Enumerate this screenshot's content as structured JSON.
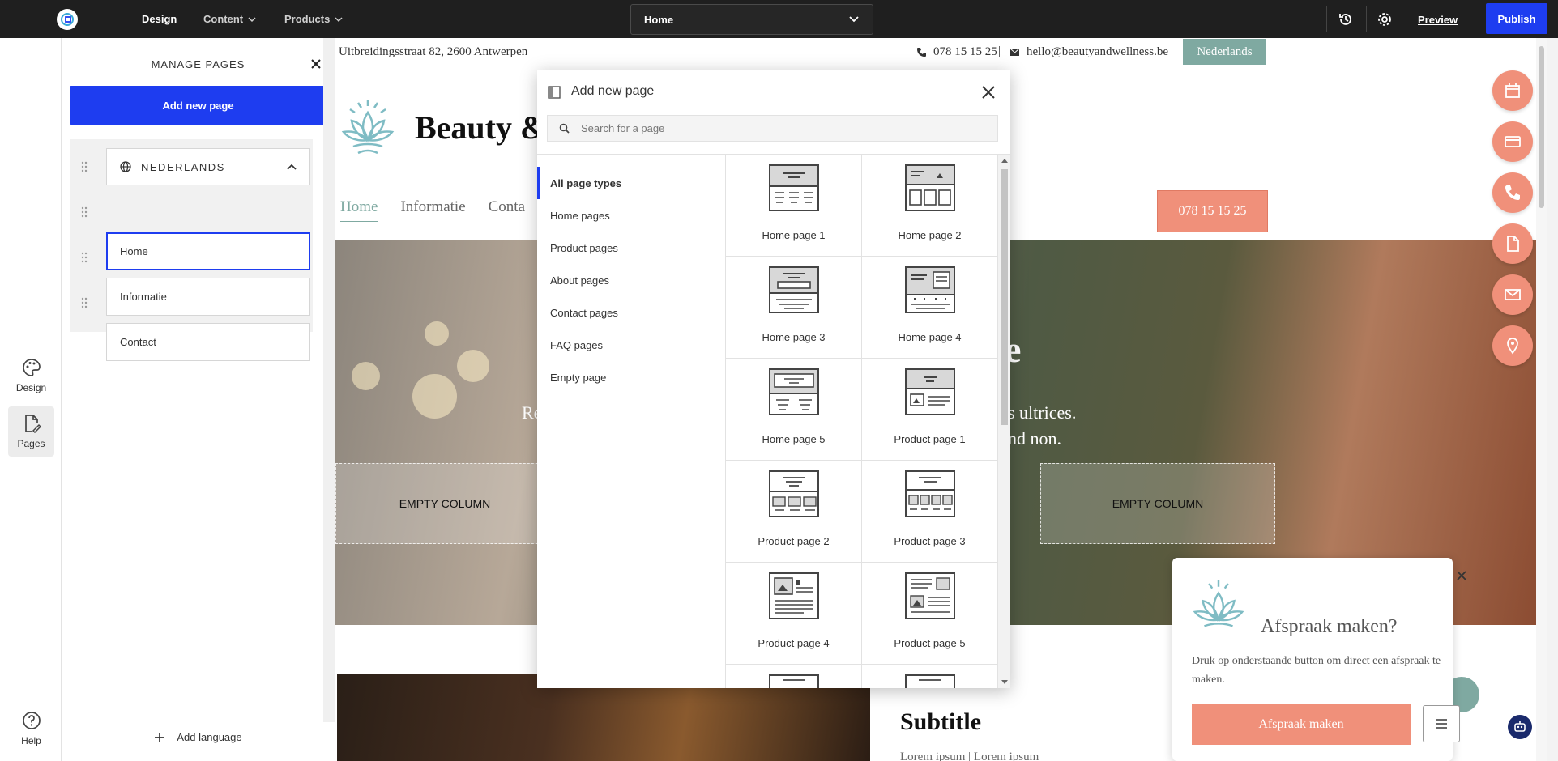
{
  "topbar": {
    "nav": [
      {
        "label": "Design"
      },
      {
        "label": "Content"
      },
      {
        "label": "Products"
      }
    ],
    "page_select": "Home",
    "preview": "Preview",
    "publish": "Publish"
  },
  "rail": {
    "design": "Design",
    "pages": "Pages",
    "help": "Help"
  },
  "manage": {
    "title": "MANAGE PAGES",
    "add_page": "Add new page",
    "language": "NEDERLANDS",
    "pages": [
      "Home",
      "Informatie",
      "Contact"
    ],
    "add_language": "Add language"
  },
  "site": {
    "address": "Uitbreidingsstraat 82, 2600 Antwerpen",
    "phone": "078 15 15 25",
    "pipe": "|",
    "email": "hello@beautyandwellness.be",
    "language": "Nederlands",
    "brand": "Beauty &",
    "nav": [
      "Home",
      "Informatie",
      "Conta"
    ],
    "call_button": "078 15 15 25",
    "hero_title": "stie",
    "hero_left": "Re",
    "hero_line1": "s ultrices.",
    "hero_line2": "nd non.",
    "empty_column": "EMPTY COLUMN",
    "subtitle": "Subtitle",
    "lorem": "Lorem ipsum | Lorem ipsum"
  },
  "popup": {
    "title": "Afspraak maken?",
    "text": "Druk op onderstaande button om direct een afspraak te maken.",
    "button": "Afspraak maken"
  },
  "modal": {
    "title": "Add new page",
    "search_placeholder": "Search for a page",
    "categories": [
      "All page types",
      "Home pages",
      "Product pages",
      "About pages",
      "Contact pages",
      "FAQ pages",
      "Empty page"
    ],
    "templates": [
      "Home page 1",
      "Home page 2",
      "Home page 3",
      "Home page 4",
      "Home page 5",
      "Product page 1",
      "Product page 2",
      "Product page 3",
      "Product page 4",
      "Product page 5"
    ]
  },
  "colors": {
    "accent": "#1e3df0",
    "coral": "#f0907a",
    "teal": "#7fa9a1",
    "topbar": "#1f1f1f"
  }
}
